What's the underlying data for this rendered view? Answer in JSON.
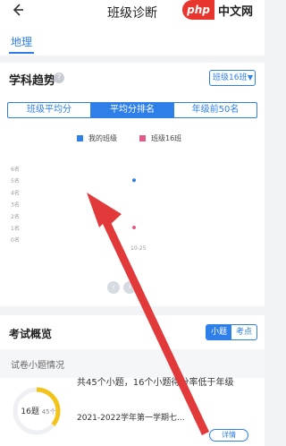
{
  "header": {
    "title": "班级诊断",
    "watermark_logo": "php",
    "watermark_text": "中文网",
    "subject_tab": "地理"
  },
  "trend": {
    "title": "学科趋势",
    "help_glyph": "?",
    "class_select": "班级16班",
    "segments": [
      {
        "label": "班级平均分",
        "active": false
      },
      {
        "label": "平均分排名",
        "active": true
      },
      {
        "label": "年级前50名",
        "active": false
      }
    ],
    "legend": [
      {
        "name": "我的班级",
        "color": "#2f7fe8"
      },
      {
        "name": "班级16班",
        "color": "#e15a8a"
      }
    ],
    "prev_page": "‹",
    "next_page": "›"
  },
  "chart_data": {
    "type": "scatter",
    "y_ticks": [
      "6名",
      "5名",
      "4名",
      "3名",
      "2名",
      "1名",
      "0名"
    ],
    "categories": [
      "",
      "10-25"
    ],
    "series": [
      {
        "name": "我的班级",
        "color": "#2f7fe8",
        "values": [
          null,
          5
        ]
      },
      {
        "name": "班级16班",
        "color": "#e15a8a",
        "values": [
          null,
          1
        ]
      }
    ],
    "ylim": [
      0,
      6
    ]
  },
  "exam": {
    "title": "考试概览",
    "toggle": [
      {
        "label": "小题",
        "active": true
      },
      {
        "label": "考点",
        "active": false
      }
    ],
    "sub_title": "试卷小题情况",
    "ring_main": "16题",
    "ring_small": "45个",
    "ring_fraction": 0.36,
    "summary": "共45个小题，16个小题得分率低于年级",
    "term": "2021-2022学年第一学期七...",
    "detail_button": "详情"
  },
  "colors": {
    "accent": "#2f7fe8",
    "arrow": "#e23a3a",
    "ring": "#f2c41a"
  }
}
